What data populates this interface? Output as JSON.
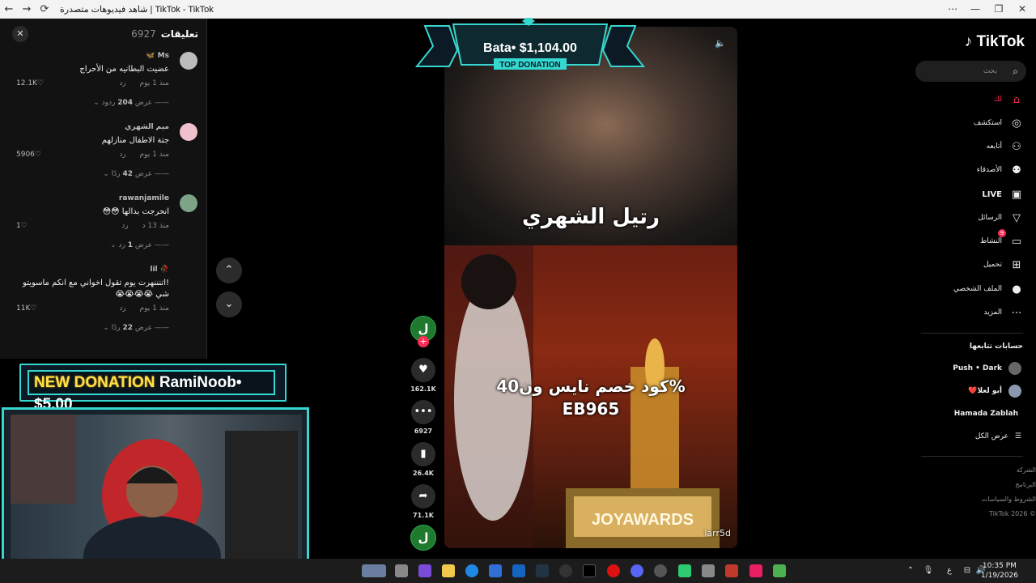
{
  "browser": {
    "title": "شاهد فيديوهات متصدرة | TikTok - TikTok",
    "back": "←",
    "forward": "→",
    "reload": "⟳",
    "more": "⋯",
    "minimize": "—",
    "restore": "❐",
    "close": "✕"
  },
  "comments_panel": {
    "title": "تعليقات",
    "count": "6927",
    "close_icon": "✕",
    "items": [
      {
        "user": "Ms 🦋",
        "text": "عضيت البطانيه من الأحراج",
        "time": "منذ 1 يوم",
        "reply": "رد",
        "likes": "12.1K♡",
        "more_label": "عرض",
        "more_count": "204",
        "more_suffix": "ردود",
        "avatar_color": "#c9c9c9"
      },
      {
        "user": "ميم الشهري",
        "text": "جتة الاطفال منازلهم",
        "time": "منذ 1 يوم",
        "reply": "رد",
        "likes": "5906♡",
        "more_label": "عرض",
        "more_count": "42",
        "more_suffix": "ردًا",
        "avatar_color": "#f3c4d0"
      },
      {
        "user": "rawanjamile",
        "text": "انحرجت بدالها 😳😳",
        "time": "منذ 13 د",
        "reply": "رد",
        "likes": "1♡",
        "more_label": "عرض",
        "more_count": "1",
        "more_suffix": "رد",
        "avatar_color": "#7fa88a"
      },
      {
        "user": "🥀 lil",
        "text": "!اتنننهرت يوم تقول اخواني مع انكم ماسويتو شي 😭😭😭😭",
        "time": "منذ 1 يوم",
        "reply": "رد",
        "likes": "11K♡",
        "more_label": "عرض",
        "more_count": "22",
        "more_suffix": "ردًا",
        "avatar_color": "#121212"
      }
    ]
  },
  "video_nav": {
    "up": "⌃",
    "down": "⌄"
  },
  "video": {
    "caption_top": "رتيل الشهري",
    "caption_bottom_line1": "كود خصم نايس ون40%",
    "caption_bottom_line2": "EB965",
    "username": "larr5d",
    "mute_icon": "🔈"
  },
  "top_donation": {
    "amount": "Bata• $1,104.00",
    "label": "TOP DONATION"
  },
  "actions": {
    "creator_initial": "ل",
    "follow_plus": "+",
    "likes": "162.1K",
    "comments": "6927",
    "saves": "26.4K",
    "shares": "71.1K",
    "music_initial": "ل"
  },
  "sidebar": {
    "logo": "TikTok",
    "search_placeholder": "بحث",
    "nav": [
      {
        "label": "لك",
        "icon": "⌂",
        "active": true
      },
      {
        "label": "استكشف",
        "icon": "◎"
      },
      {
        "label": "أتابعه",
        "icon": "⚇"
      },
      {
        "label": "الأصدقاء",
        "icon": "⚉"
      },
      {
        "label": "LIVE",
        "icon": "▣"
      },
      {
        "label": "الرسائل",
        "icon": "▽"
      },
      {
        "label": "النشاط",
        "icon": "▭",
        "badge": "9"
      },
      {
        "label": "تحميل",
        "icon": "⊞"
      },
      {
        "label": "الملف الشخصي",
        "icon": "●"
      },
      {
        "label": "المزيد",
        "icon": "⋯"
      }
    ],
    "following_title": "حسابات تتابعها",
    "following": [
      {
        "name": "Push • Dark"
      },
      {
        "name": "أبو لعلا❤️"
      },
      {
        "name": "Hamada Zablah"
      }
    ],
    "see_all": "عرض الكل",
    "footer": [
      "الشركة",
      "البرنامج",
      "الشروط والسياسات",
      "© 2026 TikTok"
    ]
  },
  "stream_overlay": {
    "new_donation_tag": "NEW DONATION",
    "new_donation_text": "RamiNoob• $5.00"
  },
  "taskbar": {
    "time": "10:35 PM",
    "date": "1/19/2026",
    "lang": "ع"
  }
}
